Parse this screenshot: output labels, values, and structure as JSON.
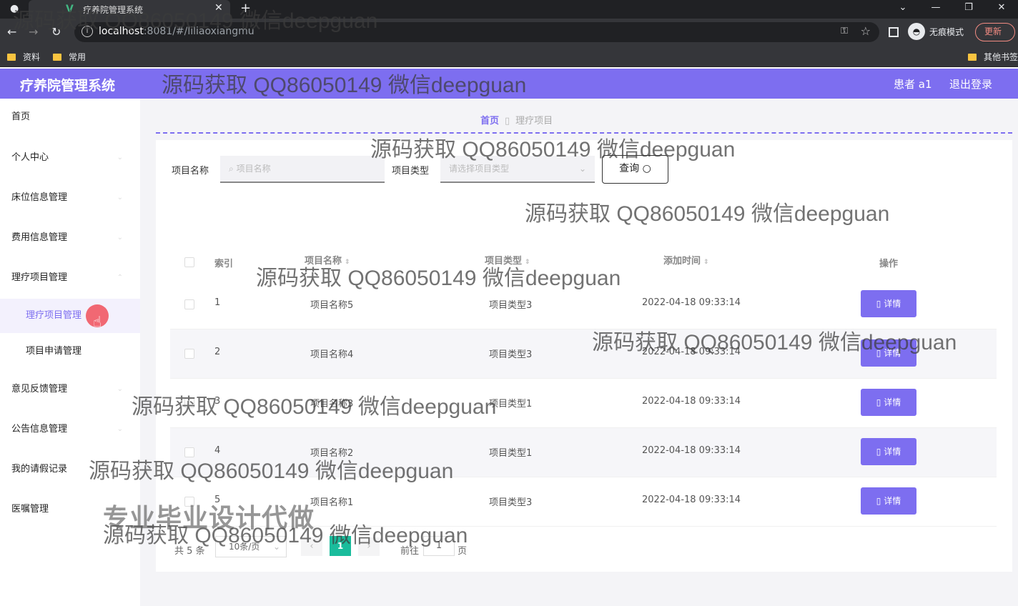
{
  "browser": {
    "tab_title": "疗养院管理系统",
    "url_host": "localhost",
    "url_path": ":8081/#/liliaoxiangmu",
    "incognito_label": "无痕模式",
    "update_label": "更新",
    "bookmarks": [
      "资料",
      "常用",
      "其他书签"
    ]
  },
  "header": {
    "title": "疗养院管理系统",
    "user": "患者 a1",
    "logout": "退出登录",
    "accent": "#7d6ef0"
  },
  "sidebar": {
    "items": [
      {
        "label": "首页"
      },
      {
        "label": "个人中心"
      },
      {
        "label": "床位信息管理"
      },
      {
        "label": "费用信息管理"
      },
      {
        "label": "理疗项目管理"
      }
    ],
    "sub_items": [
      {
        "label": "理疗项目管理",
        "active": true
      },
      {
        "label": "项目申请管理",
        "active": false
      }
    ],
    "items_after": [
      {
        "label": "意见反馈管理"
      },
      {
        "label": "公告信息管理"
      },
      {
        "label": "我的请假记录"
      },
      {
        "label": "医嘱管理"
      }
    ]
  },
  "breadcrumb": {
    "home": "首页",
    "current": "理疗项目"
  },
  "search": {
    "name_label": "项目名称",
    "name_placeholder": "项目名称",
    "type_label": "项目类型",
    "type_placeholder": "请选择项目类型",
    "button": "查询"
  },
  "table": {
    "headers": {
      "index": "索引",
      "name": "项目名称",
      "type": "项目类型",
      "time": "添加时间",
      "action": "操作"
    },
    "rows": [
      {
        "index": "1",
        "name": "项目名称5",
        "type": "项目类型3",
        "time": "2022-04-18 09:33:14",
        "action": "详情"
      },
      {
        "index": "2",
        "name": "项目名称4",
        "type": "项目类型3",
        "time": "2022-04-18 09:33:14",
        "action": "详情"
      },
      {
        "index": "3",
        "name": "项目名称3",
        "type": "项目类型1",
        "time": "2022-04-18 09:33:14",
        "action": "详情"
      },
      {
        "index": "4",
        "name": "项目名称2",
        "type": "项目类型1",
        "time": "2022-04-18 09:33:14",
        "action": "详情"
      },
      {
        "index": "5",
        "name": "项目名称1",
        "type": "项目类型3",
        "time": "2022-04-18 09:33:14",
        "action": "详情"
      }
    ]
  },
  "pager": {
    "total": "共 5 条",
    "page_size": "10条/页",
    "current_page": "1",
    "goto_label": "前往",
    "goto_value": "1",
    "page_suffix": "页"
  },
  "watermarks": {
    "contact": "源码获取 QQ86050149 微信deepguan",
    "slogan": "专业毕业设计代做"
  }
}
